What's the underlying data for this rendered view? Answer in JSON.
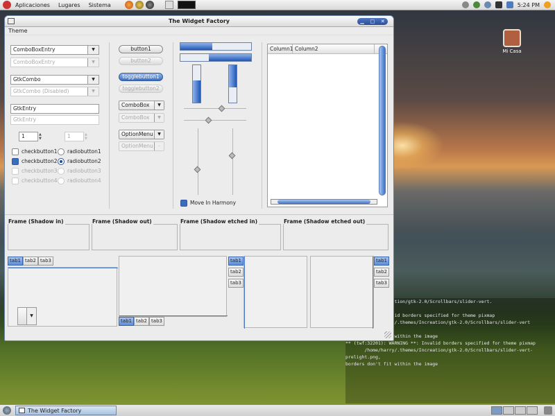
{
  "top_panel": {
    "menus": [
      "Aplicaciones",
      "Lugares",
      "Sistema"
    ],
    "clock": "5:24 PM"
  },
  "desktop_icon": {
    "label": "Mi Casa"
  },
  "window": {
    "title": "The Widget Factory",
    "menubar": {
      "theme": "Theme"
    },
    "combos": {
      "combobox_entry": "ComboBoxEntry",
      "combobox_entry_disabled": "ComboBoxEntry",
      "gtk_combo": "GtkCombo",
      "gtk_combo_disabled": "GtkCombo (Disabled)",
      "combobox": "ComboBox",
      "combobox_disabled": "ComboBox",
      "option_menu": "OptionMenu",
      "option_menu_disabled": "OptionMenu"
    },
    "entries": {
      "gtk_entry": "GtkEntry",
      "gtk_entry_disabled": "GtkEntry"
    },
    "spinbuttons": {
      "spin1": "1",
      "spin2": "1"
    },
    "checks": [
      "checkbutton1",
      "checkbutton2",
      "checkbutton3",
      "checkbutton4"
    ],
    "radios": [
      "radiobutton1",
      "radiobutton2",
      "radiobutton3",
      "radiobutton4"
    ],
    "buttons": {
      "button1": "button1",
      "button2": "button2",
      "togglebutton1": "togglebutton1",
      "togglebutton2": "togglebutton2"
    },
    "progress": {
      "h1": 0.45,
      "h2": 0.6,
      "v1": 0.6,
      "v2": 0.6
    },
    "move_in_harmony": "Move In Harmony",
    "tree": {
      "columns": [
        "Column1",
        "Column2"
      ]
    },
    "frames": [
      "Frame (Shadow in)",
      "Frame (Shadow out)",
      "Frame (Shadow etched in)",
      "Frame (Shadow etched out)"
    ],
    "tabs": [
      "tab1",
      "tab2",
      "tab3"
    ]
  },
  "taskbar": {
    "task_label": "The Widget Factory"
  },
  "terminal": {
    "lines": [
      "rry/.themes/Increation/gtk-2.0/Scrollbars/slider-vert.",
      "n within the image",
      "",
      " WARNING **: Invalid borders specified for theme pixmap",
      "       /home/harry/.themes/Increation/gtk-2.0/Scrollbars/slider-vert",
      "png,",
      "borders don't fit within the image",
      "",
      "** (twf:32201): WARNING **: Invalid borders specified for theme pixmap",
      "       /home/harry/.themes/Increation/gtk-2.0/Scrollbars/slider-vert-",
      "prelight.png,",
      "borders don't fit within the image"
    ]
  }
}
